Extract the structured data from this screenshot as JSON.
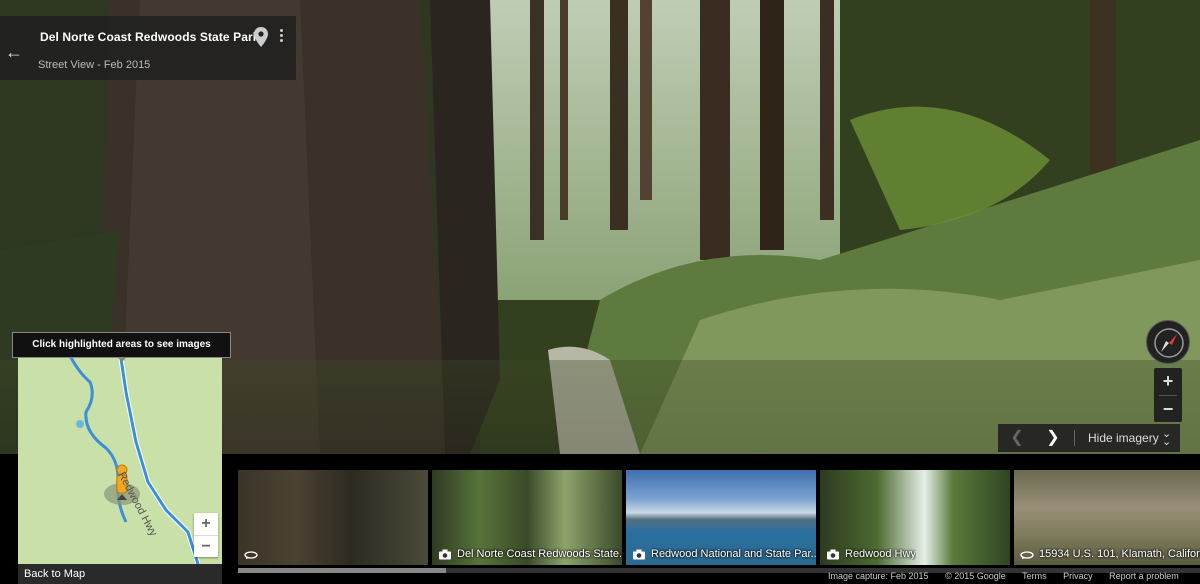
{
  "header": {
    "title": "Del Norte Coast Redwoods State Park",
    "subtitle": "Street View - Feb 2015",
    "back_icon": "back-arrow-icon",
    "pin_icon": "map-pin-icon",
    "more_icon": "more-vert-icon"
  },
  "controls": {
    "zoom_in": "+",
    "zoom_out": "−",
    "prev": "❮",
    "next": "❯",
    "hide_imagery": "Hide imagery",
    "hide_chevron": "⌄"
  },
  "minimap": {
    "tooltip": "Click highlighted areas to see images",
    "road_label": "Redwood Hwy",
    "zoom_in": "+",
    "zoom_out": "−",
    "back_to_map": "Back to Map"
  },
  "filmstrip": {
    "thumbs": [
      {
        "label": "",
        "icon": "360-icon"
      },
      {
        "label": "Del Norte Coast Redwoods State...",
        "icon": "camera-icon"
      },
      {
        "label": "Redwood National and State Par...",
        "icon": "camera-icon"
      },
      {
        "label": "Redwood Hwy",
        "icon": "camera-icon"
      },
      {
        "label": "15934 U.S. 101, Klamath, Californ...",
        "icon": "360-icon"
      }
    ]
  },
  "footer": {
    "capture": "Image capture: Feb 2015",
    "copyright": "© 2015 Google",
    "terms": "Terms",
    "privacy": "Privacy",
    "report": "Report a problem"
  },
  "colors": {
    "panel": "#222222",
    "map_land": "#c9e0a8",
    "river": "#3b8fd6",
    "pegman": "#f5a623"
  }
}
